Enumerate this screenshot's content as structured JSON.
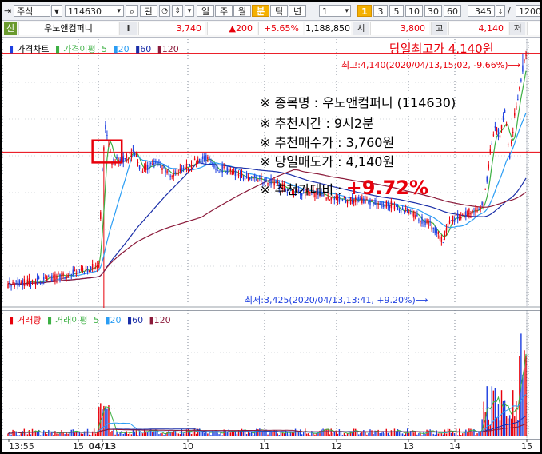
{
  "toolbar": {
    "market_select": "주식",
    "code_input": "114630",
    "search_label": "관",
    "periods": [
      "일",
      "주",
      "월",
      "분",
      "틱",
      "년"
    ],
    "selected_period": "분",
    "interval_value": "1",
    "minute_options": [
      "1",
      "3",
      "5",
      "10",
      "30",
      "60"
    ],
    "selected_minute": "1",
    "count_value": "345",
    "slash": "/",
    "total_value": "1200"
  },
  "quote": {
    "badge": "신",
    "stock_name": "우노앤컴퍼니",
    "info_label": "i",
    "price": "3,740",
    "change": "▲200",
    "change_rate": "+5.65%",
    "volume": "1,188,850",
    "open_label": "시",
    "open_value": "3,800",
    "high_label": "고",
    "high_value": "4,140",
    "low_label": "저"
  },
  "price_legend": {
    "title": "가격차트",
    "ma_title": "가격이평",
    "ma_periods": [
      "5",
      "20",
      "60",
      "120"
    ]
  },
  "volume_legend": {
    "title": "거래량",
    "ma_title": "거래이평",
    "ma_periods": [
      "5",
      "20",
      "60",
      "120"
    ]
  },
  "annotations": {
    "day_high_title": "당일최고가 4,140원",
    "high_marker": "최고:4,140(2020/04/13,15:02, -9.66%)⟶",
    "low_marker": "최저:3,425(2020/04/13,13:41, +9.20%)⟶"
  },
  "info_box": {
    "lines": [
      "※ 종목명 : 우노앤컴퍼니 (114630)",
      "※ 추천시간 : 9시2분",
      "※ 추천매수가 : 3,760원",
      "※ 당일매도가 : 4,140원"
    ],
    "ratio_label": "※ 추천가대비 : ",
    "ratio_value": "+9.72%"
  },
  "time_axis": {
    "labels": [
      "13:55",
      "15",
      "04/13",
      "10",
      "11",
      "12",
      "13",
      "14",
      "15"
    ]
  },
  "colors": {
    "up": "#e8000b",
    "down": "#1d3fe0",
    "ma5": "#3cb043",
    "ma20": "#2a9df4",
    "ma60": "#1a2ea8",
    "ma120": "#8b1a3a",
    "accent": "#f4b000"
  },
  "chart_data": [
    {
      "type": "candlestick",
      "title": "가격차트",
      "xlabel": "",
      "ylabel": "",
      "x_ticks": [
        "13:55",
        "15",
        "04/13",
        "10",
        "11",
        "12",
        "13",
        "14",
        "15"
      ],
      "ylim": [
        3180,
        4170
      ],
      "reference_lines": [
        {
          "label": "당일최고가",
          "value": 4140
        },
        {
          "label": "추천매수가",
          "value": 3760
        }
      ],
      "day_high": {
        "value": 4140,
        "time": "2020/04/13 15:02"
      },
      "day_low": {
        "value": 3425,
        "time": "2020/04/13 13:41"
      },
      "series": [
        {
          "name": "가격"
        },
        {
          "name": "5"
        },
        {
          "name": "20"
        },
        {
          "name": "60"
        },
        {
          "name": "120"
        }
      ]
    },
    {
      "type": "bar",
      "title": "거래량",
      "xlabel": "",
      "ylabel": "",
      "x_ticks": [
        "13:55",
        "15",
        "04/13",
        "10",
        "11",
        "12",
        "13",
        "14",
        "15"
      ],
      "series": [
        {
          "name": "거래량"
        },
        {
          "name": "5"
        },
        {
          "name": "20"
        },
        {
          "name": "60"
        },
        {
          "name": "120"
        }
      ]
    }
  ]
}
